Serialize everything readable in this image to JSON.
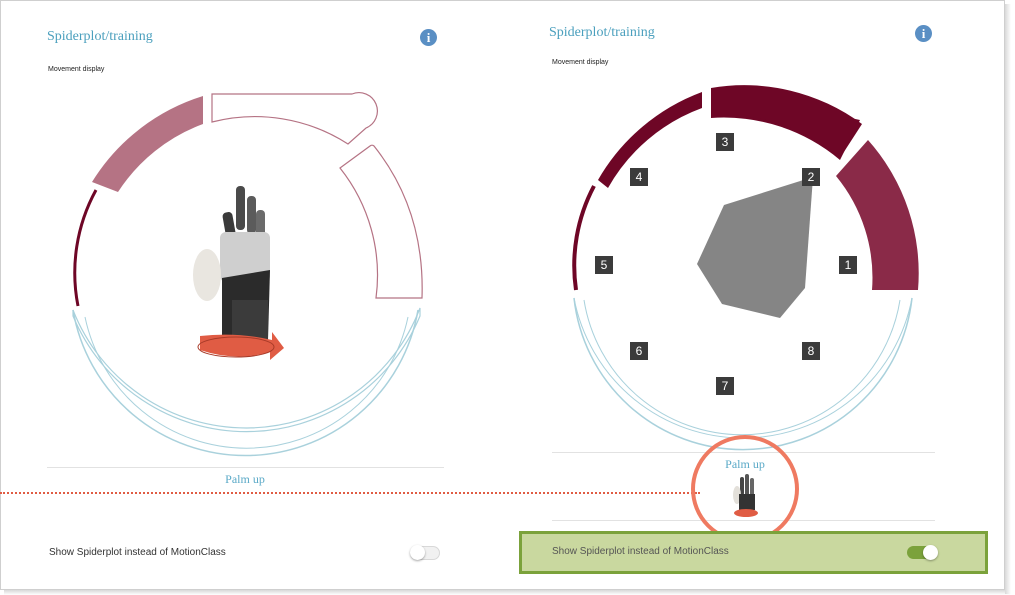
{
  "left_panel": {
    "title": "Spiderplot/training",
    "subtitle": "Movement display",
    "motion_label": "Palm up",
    "toggle_label": "Show Spiderplot instead of MotionClass",
    "toggle_on": false,
    "info_icon": "i"
  },
  "right_panel": {
    "title": "Spiderplot/training",
    "subtitle": "Movement display",
    "motion_label": "Palm up",
    "toggle_label": "Show Spiderplot instead of MotionClass",
    "toggle_on": true,
    "info_icon": "i",
    "sector_numbers": [
      "1",
      "2",
      "3",
      "4",
      "5",
      "6",
      "7",
      "8"
    ]
  },
  "colors": {
    "dark_red": "#6e0626",
    "mid_red": "#8a2a48",
    "light_red": "#b57384",
    "teal_ring": "#a9d1dc",
    "title_blue": "#4a9fbd",
    "green_panel": "#c9d89f",
    "green_border": "#7ba23b",
    "highlight": "#ef7a61",
    "spider_fill": "#858585"
  },
  "icons": [
    "info-icon",
    "hand-icon",
    "rotate-arrow-icon"
  ]
}
